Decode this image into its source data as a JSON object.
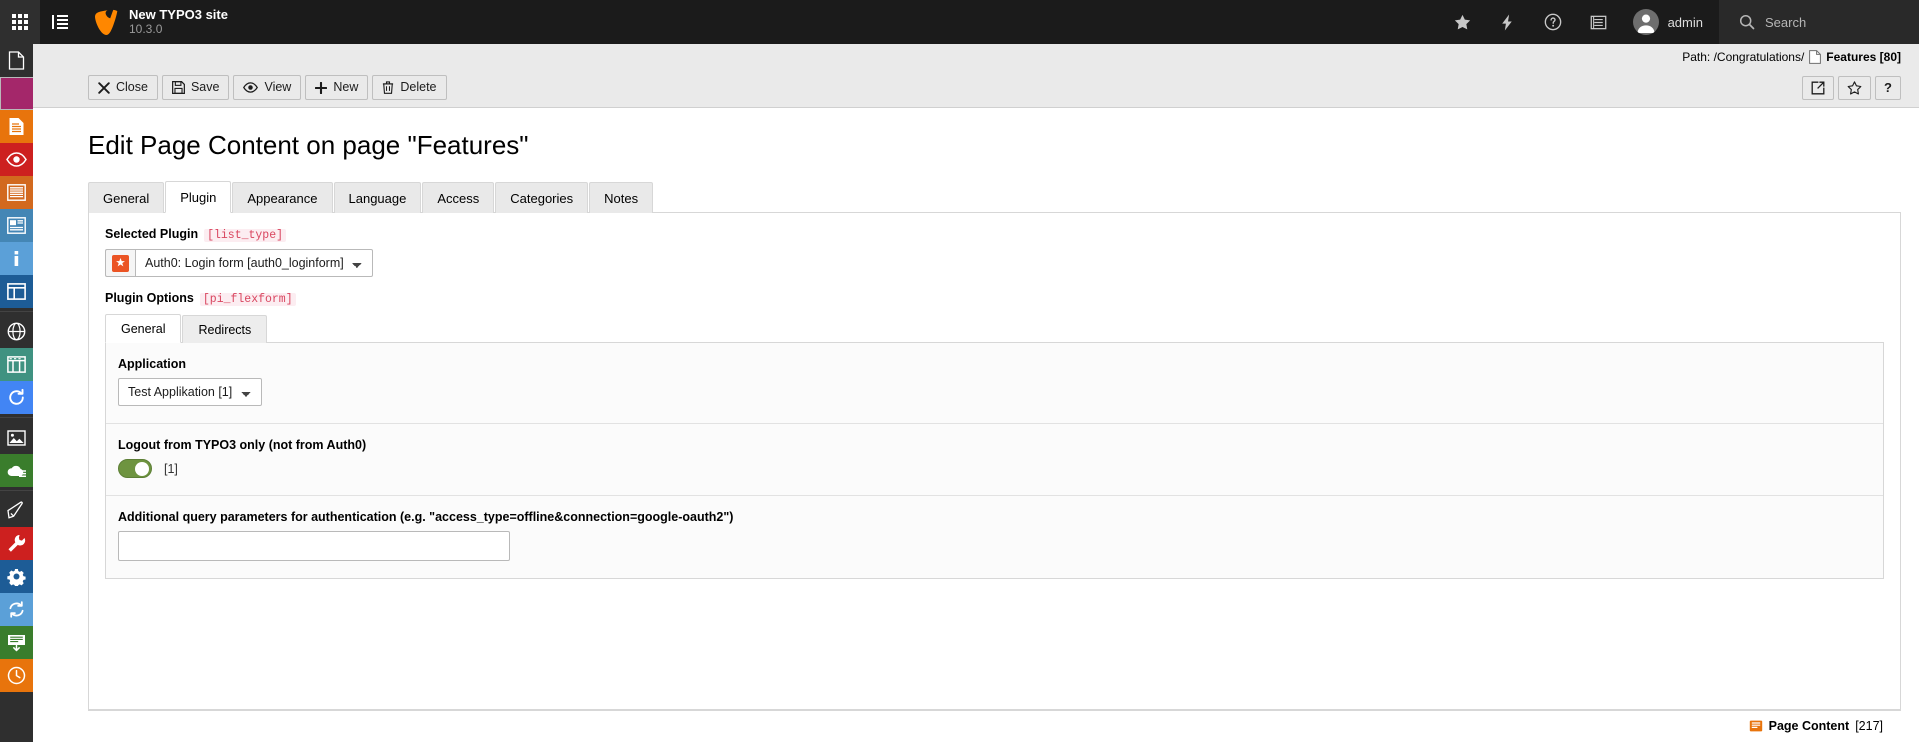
{
  "topbar": {
    "modulemenu_toggle": "module-menu-toggle",
    "listview_toggle": "list-view-toggle",
    "site_title": "New TYPO3 site",
    "site_version": "10.3.0",
    "icons": [
      "star-icon",
      "flash-icon",
      "help-icon",
      "list-icon"
    ],
    "username": "admin",
    "search_label": "Search"
  },
  "modulemenu": {
    "items": [
      {
        "name": "page-module-icon",
        "color": "none",
        "group": 1
      },
      {
        "name": "list-module-icon",
        "color": "#a4276a",
        "group": 1
      },
      {
        "name": "content-module-icon",
        "color": "#e8740c",
        "group": 1
      },
      {
        "name": "view-module-icon",
        "color": "#cd201f",
        "group": 1
      },
      {
        "name": "form-module-icon",
        "color": "#d2691e",
        "group": 1
      },
      {
        "name": "news-module-icon",
        "color": "#4486b5",
        "group": 1
      },
      {
        "name": "info-module-icon",
        "color": "#5ba0d8",
        "group": 1
      },
      {
        "name": "layout-module-icon",
        "color": "#1d5c96",
        "group": 1
      },
      {
        "name": "sites-module-icon",
        "color": "none",
        "group": 2
      },
      {
        "name": "template-module-icon",
        "color": "#3f9281",
        "group": 2
      },
      {
        "name": "recycler-module-icon",
        "color": "#4285f4",
        "group": 2
      },
      {
        "name": "filelist-module-icon",
        "color": "none",
        "group": 3
      },
      {
        "name": "cloud-module-icon",
        "color": "#3a7d2c",
        "group": 3
      },
      {
        "name": "extensions-module-icon",
        "color": "none",
        "group": 4
      },
      {
        "name": "maintenance-module-icon",
        "color": "#cd201f",
        "group": 4
      },
      {
        "name": "settings-module-icon",
        "color": "#1d5c96",
        "group": 4
      },
      {
        "name": "upgrade-module-icon",
        "color": "#5ba0d8",
        "group": 4
      },
      {
        "name": "environment-module-icon",
        "color": "#3a7d2c",
        "group": 4
      },
      {
        "name": "scheduler-module-icon",
        "color": "#e8740c",
        "group": 4
      }
    ]
  },
  "pathbar": {
    "path_label": "Path: /Congratulations/",
    "record_icon": "page-icon",
    "record_title": "Features [80]"
  },
  "docheader": {
    "buttons": [
      {
        "label": "Close",
        "icon": "close-icon"
      },
      {
        "label": "Save",
        "icon": "save-icon"
      },
      {
        "label": "View",
        "icon": "view-icon"
      },
      {
        "label": "New",
        "icon": "plus-icon"
      },
      {
        "label": "Delete",
        "icon": "trash-icon"
      }
    ],
    "right_buttons": [
      {
        "name": "open-in-new-window-button",
        "icon": "external-link-icon"
      },
      {
        "name": "bookmark-button",
        "icon": "star-outline-icon"
      },
      {
        "name": "help-button",
        "icon": "question-mark-icon",
        "label": "?"
      }
    ]
  },
  "main": {
    "page_title": "Edit Page Content on page \"Features\"",
    "tabs": [
      {
        "label": "General",
        "active": false
      },
      {
        "label": "Plugin",
        "active": true
      },
      {
        "label": "Appearance",
        "active": false
      },
      {
        "label": "Language",
        "active": false
      },
      {
        "label": "Access",
        "active": false
      },
      {
        "label": "Categories",
        "active": false
      },
      {
        "label": "Notes",
        "active": false
      }
    ],
    "selected_plugin": {
      "label": "Selected Plugin",
      "code": "[list_type]",
      "icon": "auth0-logo-icon",
      "value": "Auth0: Login form [auth0_loginform]",
      "options": [
        "Auth0: Login form [auth0_loginform]"
      ]
    },
    "plugin_options": {
      "label": "Plugin Options",
      "code": "[pi_flexform]",
      "tabs": [
        {
          "label": "General",
          "active": true
        },
        {
          "label": "Redirects",
          "active": false
        }
      ],
      "fields": {
        "application": {
          "label": "Application",
          "value": "Test Applikation [1]",
          "options": [
            "Test Applikation [1]"
          ]
        },
        "logout": {
          "label": "Logout from TYPO3 only (not from Auth0)",
          "toggle_on": true,
          "value": "[1]"
        },
        "query_params": {
          "label": "Additional query parameters for authentication (e.g. \"access_type=offline&connection=google-oauth2\")",
          "value": "",
          "placeholder": ""
        }
      }
    }
  },
  "footer": {
    "icon": "content-element-icon",
    "record_name": "Page Content",
    "record_uid": "[217]"
  }
}
